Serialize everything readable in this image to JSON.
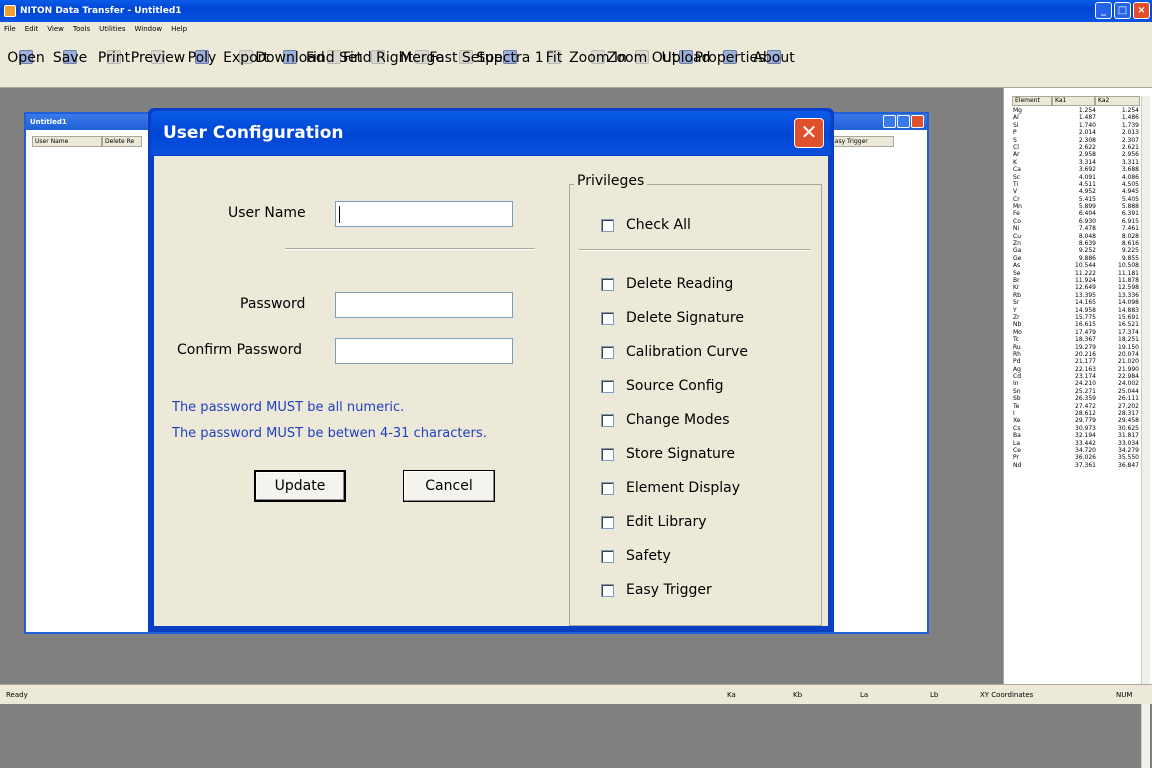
{
  "app": {
    "title": "NITON Data Transfer - Untitled1"
  },
  "menu": [
    "File",
    "Edit",
    "View",
    "Tools",
    "Utilities",
    "Window",
    "Help"
  ],
  "toolbar": [
    {
      "label": "Open",
      "enabled": true
    },
    {
      "label": "Save",
      "enabled": true
    },
    {
      "label": "Print",
      "enabled": false
    },
    {
      "label": "Preview",
      "enabled": false
    },
    {
      "label": "Poly",
      "enabled": true
    },
    {
      "label": "Export",
      "enabled": false
    },
    {
      "label": "Download",
      "enabled": true
    },
    {
      "label": "Find Set",
      "enabled": false
    },
    {
      "label": "Find Right",
      "enabled": false
    },
    {
      "label": "Merge",
      "enabled": false
    },
    {
      "label": "Fast Setup",
      "enabled": false
    },
    {
      "label": "Spectra 1",
      "enabled": true
    },
    {
      "label": "Fit",
      "enabled": false
    },
    {
      "label": "Zoom In",
      "enabled": false
    },
    {
      "label": "Zoom Out",
      "enabled": false
    },
    {
      "label": "Upload",
      "enabled": true
    },
    {
      "label": "Properties",
      "enabled": true
    },
    {
      "label": "About",
      "enabled": true
    }
  ],
  "element_table": {
    "headers": [
      "Element",
      "Ka1",
      "Ka2"
    ],
    "rows": [
      [
        "Mg",
        "1.254",
        "1.254"
      ],
      [
        "Al",
        "1.487",
        "1.486"
      ],
      [
        "Si",
        "1.740",
        "1.739"
      ],
      [
        "P",
        "2.014",
        "2.013"
      ],
      [
        "S",
        "2.308",
        "2.307"
      ],
      [
        "Cl",
        "2.622",
        "2.621"
      ],
      [
        "Ar",
        "2.958",
        "2.956"
      ],
      [
        "K",
        "3.314",
        "3.311"
      ],
      [
        "Ca",
        "3.692",
        "3.688"
      ],
      [
        "Sc",
        "4.091",
        "4.086"
      ],
      [
        "Ti",
        "4.511",
        "4.505"
      ],
      [
        "V",
        "4.952",
        "4.945"
      ],
      [
        "Cr",
        "5.415",
        "5.405"
      ],
      [
        "Mn",
        "5.899",
        "5.888"
      ],
      [
        "Fe",
        "6.404",
        "6.391"
      ],
      [
        "Co",
        "6.930",
        "6.915"
      ],
      [
        "Ni",
        "7.478",
        "7.461"
      ],
      [
        "Cu",
        "8.048",
        "8.028"
      ],
      [
        "Zn",
        "8.639",
        "8.616"
      ],
      [
        "Ga",
        "9.252",
        "9.225"
      ],
      [
        "Ge",
        "9.886",
        "9.855"
      ],
      [
        "As",
        "10.544",
        "10.508"
      ],
      [
        "Se",
        "11.222",
        "11.181"
      ],
      [
        "Br",
        "11.924",
        "11.878"
      ],
      [
        "Kr",
        "12.649",
        "12.598"
      ],
      [
        "Rb",
        "13.395",
        "13.336"
      ],
      [
        "Sr",
        "14.165",
        "14.098"
      ],
      [
        "Y",
        "14.958",
        "14.883"
      ],
      [
        "Zr",
        "15.775",
        "15.691"
      ],
      [
        "Nb",
        "16.615",
        "16.521"
      ],
      [
        "Mo",
        "17.479",
        "17.374"
      ],
      [
        "Tc",
        "18.367",
        "18.251"
      ],
      [
        "Ru",
        "19.279",
        "19.150"
      ],
      [
        "Rh",
        "20.216",
        "20.074"
      ],
      [
        "Pd",
        "21.177",
        "21.020"
      ],
      [
        "Ag",
        "22.163",
        "21.990"
      ],
      [
        "Cd",
        "23.174",
        "22.984"
      ],
      [
        "In",
        "24.210",
        "24.002"
      ],
      [
        "Sn",
        "25.271",
        "25.044"
      ],
      [
        "Sb",
        "26.359",
        "26.111"
      ],
      [
        "Te",
        "27.472",
        "27.202"
      ],
      [
        "I",
        "28.612",
        "28.317"
      ],
      [
        "Xe",
        "29.779",
        "29.458"
      ],
      [
        "Cs",
        "30.973",
        "30.625"
      ],
      [
        "Ba",
        "32.194",
        "31.817"
      ],
      [
        "La",
        "33.442",
        "33.034"
      ],
      [
        "Ce",
        "34.720",
        "34.279"
      ],
      [
        "Pr",
        "36.026",
        "35.550"
      ],
      [
        "Nd",
        "37.361",
        "36.847"
      ]
    ]
  },
  "mdi": {
    "title": "Untitled1",
    "columns": [
      "User Name",
      "Delete Re",
      "Easy Trigger"
    ]
  },
  "dialog": {
    "title": "User Configuration",
    "user_name_label": "User Name",
    "password_label": "Password",
    "confirm_password_label": "Confirm Password",
    "info1": "The password MUST be all numeric.",
    "info2": "The password MUST be betwen 4-31 characters.",
    "update": "Update",
    "cancel": "Cancel",
    "privileges_title": "Privileges",
    "check_all": "Check All",
    "privileges": [
      "Delete Reading",
      "Delete Signature",
      "Calibration Curve",
      "Source Config",
      "Change Modes",
      "Store Signature",
      "Element Display",
      "Edit Library",
      "Safety",
      "Easy Trigger"
    ]
  },
  "status": {
    "ready": "Ready",
    "ka": "Ka",
    "kb": "Kb",
    "la": "La",
    "lb": "Lb",
    "xy": "XY Coordinates",
    "num": "NUM"
  }
}
